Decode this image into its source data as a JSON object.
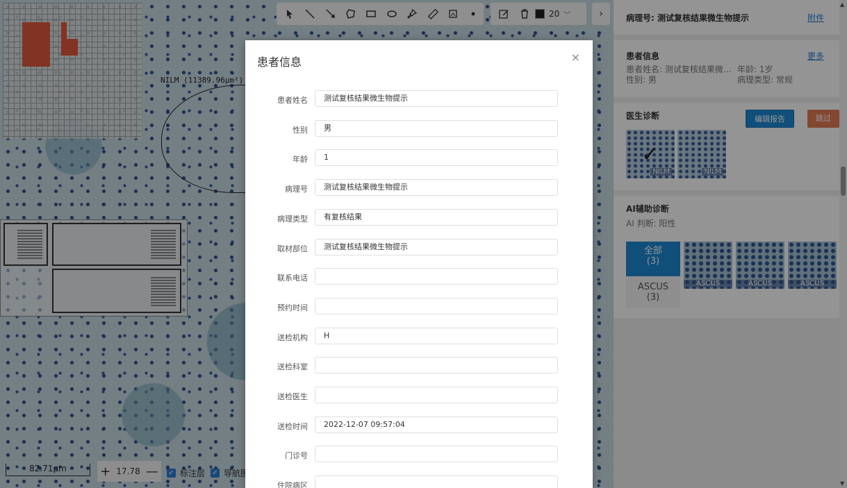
{
  "viewer": {
    "annotation_label": "NILM (11389.96μm²)",
    "scale_label": "82.71μm",
    "zoom_value": "17.78",
    "toolbar": {
      "line_width": "20"
    },
    "layers": [
      {
        "label": "标注层",
        "checked": true
      },
      {
        "label": "导航图",
        "checked": true
      }
    ]
  },
  "sidebar": {
    "title": "病理号: 测试复核结果微生物提示",
    "attachment_link": "附件",
    "patient": {
      "heading": "患者信息",
      "more_link": "更多",
      "name": "患者姓名: 测试复核结果微...",
      "age": "年龄: 1岁",
      "gender": "性别: 男",
      "path_type": "病理类型: 常规"
    },
    "doctor": {
      "heading": "医生诊断",
      "edit_button": "编辑报告",
      "skip_button": "跳过",
      "thumbs": [
        "NILM",
        "NILM"
      ]
    },
    "ai": {
      "heading": "AI辅助诊断",
      "judge": "AI 判断: 阳性",
      "all_label": "全部",
      "all_count": "(3)",
      "ascus_label": "ASCUS",
      "ascus_count": "(3)",
      "thumbs": [
        "ASCUS",
        "ASCUS",
        "ASCUS"
      ]
    }
  },
  "modal": {
    "title": "患者信息",
    "close": "×",
    "fields": [
      {
        "label": "患者姓名",
        "value": "测试复核结果微生物提示"
      },
      {
        "label": "性别",
        "value": "男"
      },
      {
        "label": "年龄",
        "value": "1"
      },
      {
        "label": "病理号",
        "value": "测试复核结果微生物提示"
      },
      {
        "label": "病理类型",
        "value": "有复核结果"
      },
      {
        "label": "取材部位",
        "value": "测试复核结果微生物提示"
      },
      {
        "label": "联系电话",
        "value": ""
      },
      {
        "label": "预约时间",
        "value": ""
      },
      {
        "label": "送检机构",
        "value": "H"
      },
      {
        "label": "送检科室",
        "value": ""
      },
      {
        "label": "送检医生",
        "value": ""
      },
      {
        "label": "送检时间",
        "value": "2022-12-07 09:57:04"
      },
      {
        "label": "门诊号",
        "value": ""
      },
      {
        "label": "住院病区",
        "value": ""
      }
    ]
  },
  "colors": {
    "primary": "#1d89d4",
    "skip": "#e27b57",
    "link": "#2e7fd6"
  }
}
